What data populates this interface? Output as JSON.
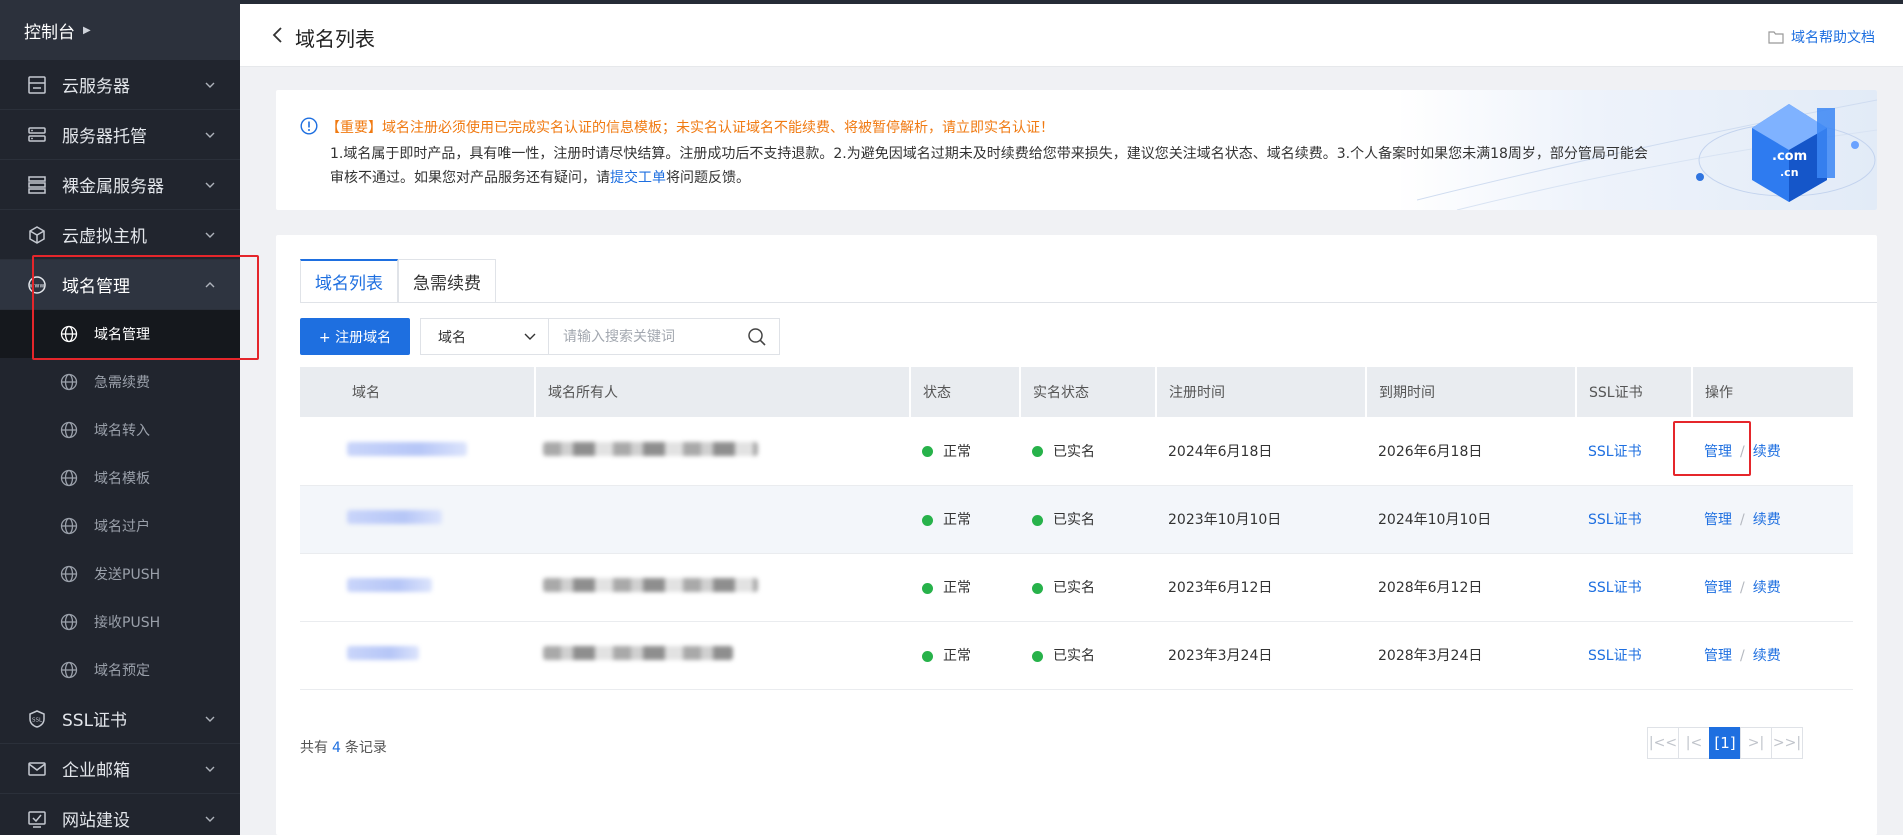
{
  "sidebar": {
    "console": "控制台",
    "items": [
      {
        "label": "云服务器",
        "icon": "server-icon"
      },
      {
        "label": "服务器托管",
        "icon": "hosting-icon"
      },
      {
        "label": "裸金属服务器",
        "icon": "bare-metal-icon"
      },
      {
        "label": "云虚拟主机",
        "icon": "cube-icon"
      },
      {
        "label": "域名管理",
        "icon": "www-icon"
      },
      {
        "label": "SSL证书",
        "icon": "ssl-icon"
      },
      {
        "label": "企业邮箱",
        "icon": "mail-icon"
      },
      {
        "label": "网站建设",
        "icon": "website-icon"
      }
    ],
    "sub_items": [
      {
        "label": "域名管理"
      },
      {
        "label": "急需续费"
      },
      {
        "label": "域名转入"
      },
      {
        "label": "域名模板"
      },
      {
        "label": "域名过户"
      },
      {
        "label": "发送PUSH"
      },
      {
        "label": "接收PUSH"
      },
      {
        "label": "域名预定"
      }
    ]
  },
  "header": {
    "title": "域名列表",
    "help_link": "域名帮助文档"
  },
  "notice": {
    "warning": "【重要】域名注册必须使用已完成实名认证的信息模板；未实名认证域名不能续费、将被暂停解析，请立即实名认证！",
    "body_before_link": "1.域名属于即时产品，具有唯一性，注册时请尽快结算。注册成功后不支持退款。2.为避免因域名过期未及时续费给您带来损失，建议您关注域名状态、域名续费。3.个人备案时如果您未满18周岁，部分管局可能会审核不通过。如果您对产品服务还有疑问，请",
    "link": "提交工单",
    "body_after_link": "将问题反馈。",
    "art_labels": [
      ".com",
      ".cn"
    ]
  },
  "tabs": [
    {
      "label": "域名列表",
      "active": true
    },
    {
      "label": "急需续费",
      "active": false
    }
  ],
  "toolbar": {
    "register_button": "+ 注册域名",
    "select_value": "域名",
    "search_placeholder": "请输入搜索关键词"
  },
  "table": {
    "columns": [
      "域名",
      "域名所有人",
      "状态",
      "实名状态",
      "注册时间",
      "到期时间",
      "SSL证书",
      "操作"
    ],
    "rows": [
      {
        "status": "正常",
        "realname": "已实名",
        "reg": "2024年6月18日",
        "exp": "2026年6月18日",
        "ssl": "SSL证书",
        "manage": "管理",
        "renew": "续费"
      },
      {
        "status": "正常",
        "realname": "已实名",
        "reg": "2023年10月10日",
        "exp": "2024年10月10日",
        "ssl": "SSL证书",
        "manage": "管理",
        "renew": "续费"
      },
      {
        "status": "正常",
        "realname": "已实名",
        "reg": "2023年6月12日",
        "exp": "2028年6月12日",
        "ssl": "SSL证书",
        "manage": "管理",
        "renew": "续费"
      },
      {
        "status": "正常",
        "realname": "已实名",
        "reg": "2023年3月24日",
        "exp": "2028年3月24日",
        "ssl": "SSL证书",
        "manage": "管理",
        "renew": "续费"
      }
    ]
  },
  "footer": {
    "count_prefix": "共有",
    "count": "4",
    "count_suffix": "条记录",
    "pager": {
      "first": "|<<",
      "prev": "|<",
      "current": "[1]",
      "next": ">|",
      "last": ">>|"
    }
  },
  "colors": {
    "accent": "#1e6fe0",
    "warning": "#f07a12",
    "success": "#27b24a",
    "highlight": "#e5262b",
    "sidebar": "#21252e"
  }
}
